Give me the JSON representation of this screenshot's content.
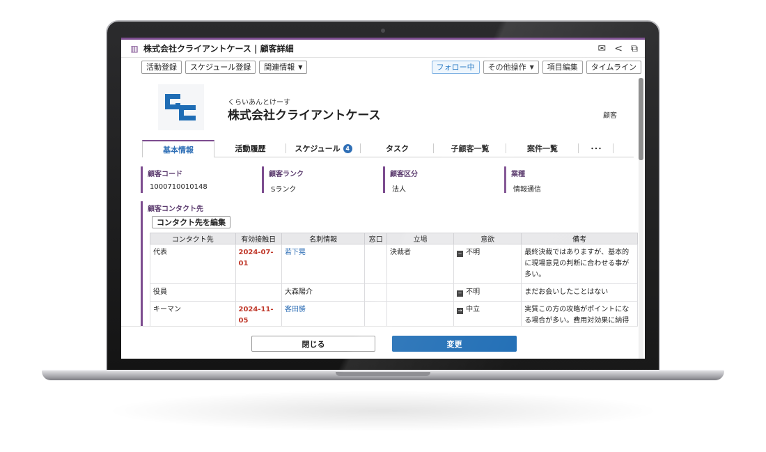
{
  "window": {
    "title": "株式会社クライアントケース | 顧客詳細",
    "title_icon": "building-icon",
    "actions": [
      "mail-icon",
      "share-icon",
      "external-link-icon"
    ]
  },
  "toolbar": {
    "activity_register": "活動登録",
    "schedule_register": "スケジュール登録",
    "related_info": "関連情報",
    "follow": "フォロー中",
    "other_ops": "その他操作",
    "edit_items": "項目編集",
    "timeline": "タイムライン"
  },
  "header": {
    "kana": "くらいあんとけーす",
    "company_name": "株式会社クライアントケース",
    "record_type": "顧客",
    "logo_color": "#1f6db5"
  },
  "tabs": [
    {
      "label": "基本情報",
      "active": true
    },
    {
      "label": "活動履歴"
    },
    {
      "label": "スケジュール",
      "badge": "4"
    },
    {
      "label": "タスク"
    },
    {
      "label": "子顧客一覧"
    },
    {
      "label": "案件一覧"
    },
    {
      "label": "･･･"
    }
  ],
  "fields": [
    {
      "label": "顧客コード",
      "value": "1000710010148"
    },
    {
      "label": "顧客ランク",
      "value": "Sランク"
    },
    {
      "label": "顧客区分",
      "value": "法人"
    },
    {
      "label": "業種",
      "value": "情報通信"
    }
  ],
  "contacts": {
    "section_label": "顧客コンタクト先",
    "edit_button": "コンタクト先を編集",
    "columns": [
      "コンタクト先",
      "有効接触日",
      "名刺情報",
      "窓口",
      "立場",
      "意欲",
      "備考"
    ],
    "rows": [
      {
        "contact": "代表",
        "date": "2024-07-01",
        "card": "若下晃",
        "window": "",
        "position": "決裁者",
        "motivation": "不明",
        "motivation_icon": "minus-square-icon",
        "note": "最終決裁ではありますが、基本的に現場意見の判断に合わせる事が多い。"
      },
      {
        "contact": "役員",
        "date": "",
        "card": "大森陽介",
        "window": "",
        "position": "",
        "motivation": "不明",
        "motivation_icon": "minus-square-icon",
        "note": "まだお会いしたことはない"
      },
      {
        "contact": "キーマン",
        "date": "2024-11-05",
        "card": "客田勝",
        "window": "",
        "position": "",
        "motivation": "中立",
        "motivation_icon": "arrow-right-square-icon",
        "note": "実質この方の攻略がポイントになる場合が多い。費用対効果に納得感ある説明が必"
      }
    ]
  },
  "footer": {
    "close": "閉じる",
    "change": "変更"
  },
  "colors": {
    "accent": "#7c4c8f",
    "primary": "#1f6db5",
    "date_red": "#c0392b"
  }
}
